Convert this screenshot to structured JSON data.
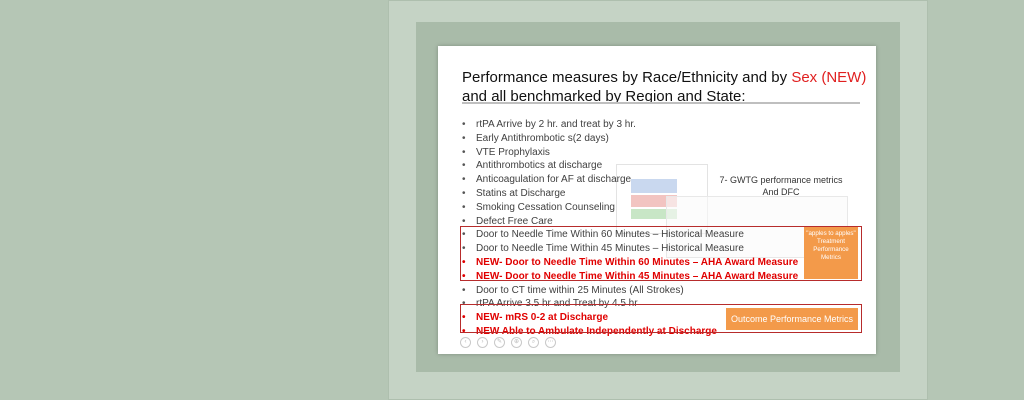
{
  "slide": {
    "title_part1": "Performance measures by Race/Ethnicity and by ",
    "title_highlight": "Sex (NEW)",
    "title_part2": "and all benchmarked by Region and State:",
    "gwtg_line1": "7- GWTG performance metrics",
    "gwtg_line2": "And DFC",
    "orange_box_1": "\"apples to apples\" Treatment Performance Metrics",
    "orange_box_2": "Outcome Performance Metrics",
    "items": [
      {
        "text": "rtPA Arrive by 2 hr. and treat by 3 hr.",
        "highlight": false
      },
      {
        "text": "Early Antithrombotic s(2 days)",
        "highlight": false
      },
      {
        "text": "VTE Prophylaxis",
        "highlight": false
      },
      {
        "text": "Antithrombotics at discharge",
        "highlight": false
      },
      {
        "text": "Anticoagulation for AF at discharge",
        "highlight": false
      },
      {
        "text": "Statins at Discharge",
        "highlight": false
      },
      {
        "text": "Smoking Cessation Counseling",
        "highlight": false
      },
      {
        "text": "Defect Free Care",
        "highlight": false
      },
      {
        "text": "Door to Needle Time Within 60 Minutes – Historical Measure",
        "highlight": false
      },
      {
        "text": "Door to Needle Time Within 45 Minutes – Historical Measure",
        "highlight": false
      },
      {
        "text": "NEW- Door to Needle Time Within 60 Minutes – AHA Award Measure",
        "highlight": true
      },
      {
        "text": "NEW- Door to Needle Time Within 45 Minutes – AHA Award Measure",
        "highlight": true
      },
      {
        "text": "Door to CT time within 25 Minutes (All Strokes)",
        "highlight": false
      },
      {
        "text": "rtPA Arrive 3.5 hr and Treat by 4.5 hr",
        "highlight": false
      },
      {
        "text": "NEW- mRS 0-2 at Discharge",
        "highlight": true
      },
      {
        "text": "NEW Able to Ambulate Independently at Discharge",
        "highlight": true
      }
    ]
  },
  "colors": {
    "background": "#b5c6b5",
    "accent_red": "#e00000",
    "box_border": "#b72c2c",
    "orange": "#f39a4a"
  }
}
